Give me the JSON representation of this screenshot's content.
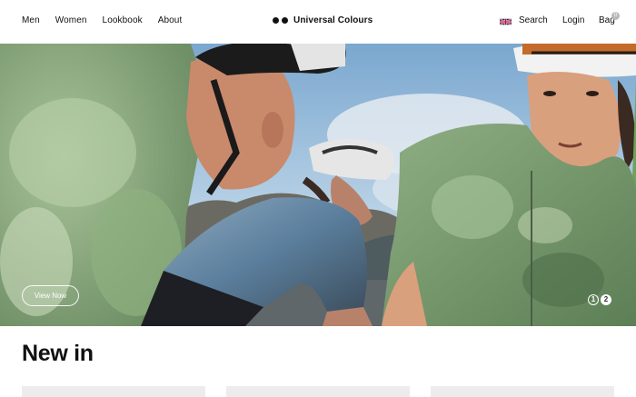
{
  "header": {
    "nav": [
      "Men",
      "Women",
      "Lookbook",
      "About"
    ],
    "brand": "Universal Colours",
    "search_label": "Search",
    "login_label": "Login",
    "bag_label": "Bag",
    "bag_count": "0"
  },
  "hero": {
    "cta_label": "View Now",
    "pager": [
      "1",
      "2"
    ],
    "current_slide": "2"
  },
  "new_in": {
    "title": "New in"
  },
  "colors": {
    "accent": "#111111",
    "jersey_green": "#7a9a6f",
    "sky": "#8ab4d6"
  }
}
